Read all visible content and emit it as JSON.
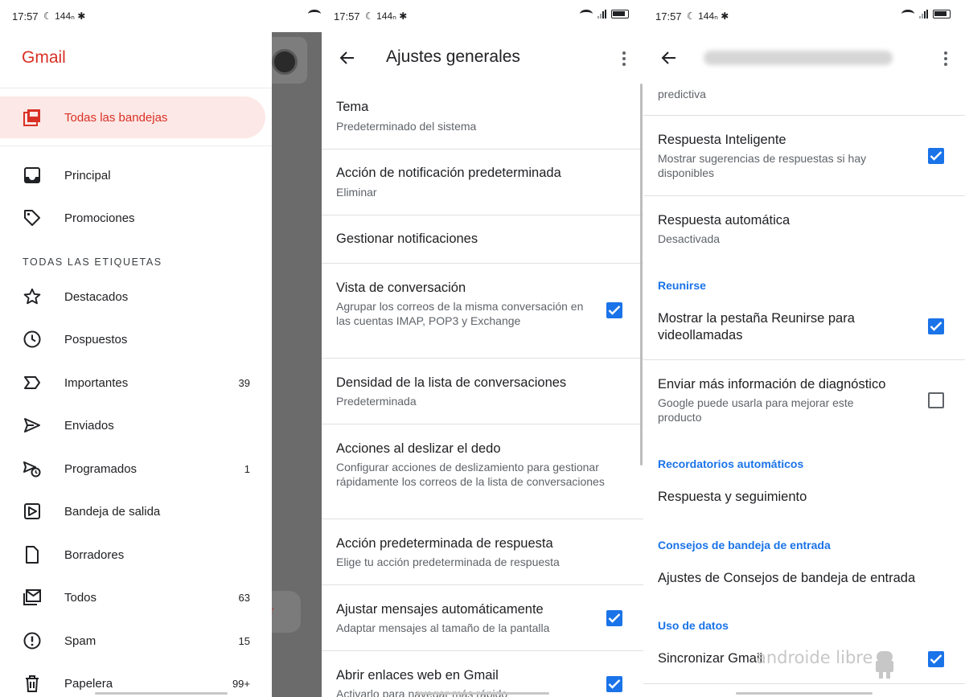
{
  "status_bar": {
    "time": "17:57",
    "left_icons": "☾ 144ₙ ✱"
  },
  "drawer": {
    "logo": "Gmail",
    "active_item": {
      "label": "Todas las bandejas"
    },
    "items_top": [
      {
        "label": "Principal",
        "icon": "inbox-icon"
      },
      {
        "label": "Promociones",
        "icon": "tag-icon"
      }
    ],
    "section_header": "TODAS LAS ETIQUETAS",
    "labels": [
      {
        "label": "Destacados",
        "count": "",
        "icon": "star-icon"
      },
      {
        "label": "Pospuestos",
        "count": "",
        "icon": "clock-icon"
      },
      {
        "label": "Importantes",
        "count": "39",
        "icon": "important-icon"
      },
      {
        "label": "Enviados",
        "count": "",
        "icon": "send-icon"
      },
      {
        "label": "Programados",
        "count": "1",
        "icon": "scheduled-icon"
      },
      {
        "label": "Bandeja de salida",
        "count": "",
        "icon": "outbox-icon"
      },
      {
        "label": "Borradores",
        "count": "",
        "icon": "draft-icon"
      },
      {
        "label": "Todos",
        "count": "63",
        "icon": "all-mail-icon"
      },
      {
        "label": "Spam",
        "count": "15",
        "icon": "spam-icon"
      },
      {
        "label": "Papelera",
        "count": "99+",
        "icon": "trash-icon"
      }
    ],
    "fab_fragment": "r"
  },
  "general": {
    "title": "Ajustes generales",
    "rows": [
      {
        "title": "Tema",
        "subtitle": "Predeterminado del sistema"
      },
      {
        "title": "Acción de notificación predeterminada",
        "subtitle": "Eliminar"
      },
      {
        "title": "Gestionar notificaciones",
        "subtitle": ""
      },
      {
        "title": "Vista de conversación",
        "subtitle": "Agrupar los correos de la misma conversación en las cuentas IMAP, POP3 y Exchange",
        "checked": true
      },
      {
        "title": "Densidad de la lista de conversaciones",
        "subtitle": "Predeterminada"
      },
      {
        "title": "Acciones al deslizar el dedo",
        "subtitle": "Configurar acciones de deslizamiento para gestionar rápidamente los correos de la lista de conversaciones"
      },
      {
        "title": "Acción predeterminada de respuesta",
        "subtitle": "Elige tu acción predeterminada de respuesta"
      },
      {
        "title": "Ajustar mensajes automáticamente",
        "subtitle": "Adaptar mensajes al tamaño de la pantalla",
        "checked": true
      },
      {
        "title": "Abrir enlaces web en Gmail",
        "subtitle": "Activarlo para navegar más rápido",
        "checked": true
      }
    ]
  },
  "account": {
    "top_fragment": "predictiva",
    "rows": [
      {
        "title": "Respuesta Inteligente",
        "subtitle": "Mostrar sugerencias de respuestas si hay disponibles",
        "checked": true
      },
      {
        "title": "Respuesta automática",
        "subtitle": "Desactivada"
      }
    ],
    "cat_meet": "Reunirse",
    "meet_row": {
      "title": "Mostrar la pestaña Reunirse para videollamadas",
      "checked": true
    },
    "diag_row": {
      "title": "Enviar más información de diagnóstico",
      "subtitle": "Google puede usarla para mejorar este producto",
      "checked": false
    },
    "cat_reminders": "Recordatorios automáticos",
    "reminders_row": {
      "title": "Respuesta y seguimiento"
    },
    "cat_tips": "Consejos de bandeja de entrada",
    "tips_row": {
      "title": "Ajustes de Consejos de bandeja de entrada"
    },
    "cat_data": "Uso de datos",
    "sync_row": {
      "title": "Sincronizar Gmail",
      "checked": true
    },
    "watermark": "androide libre"
  },
  "colors": {
    "accent_red": "#d93025",
    "active_bg": "#fce8e6",
    "checkbox_blue": "#1a73e8"
  }
}
